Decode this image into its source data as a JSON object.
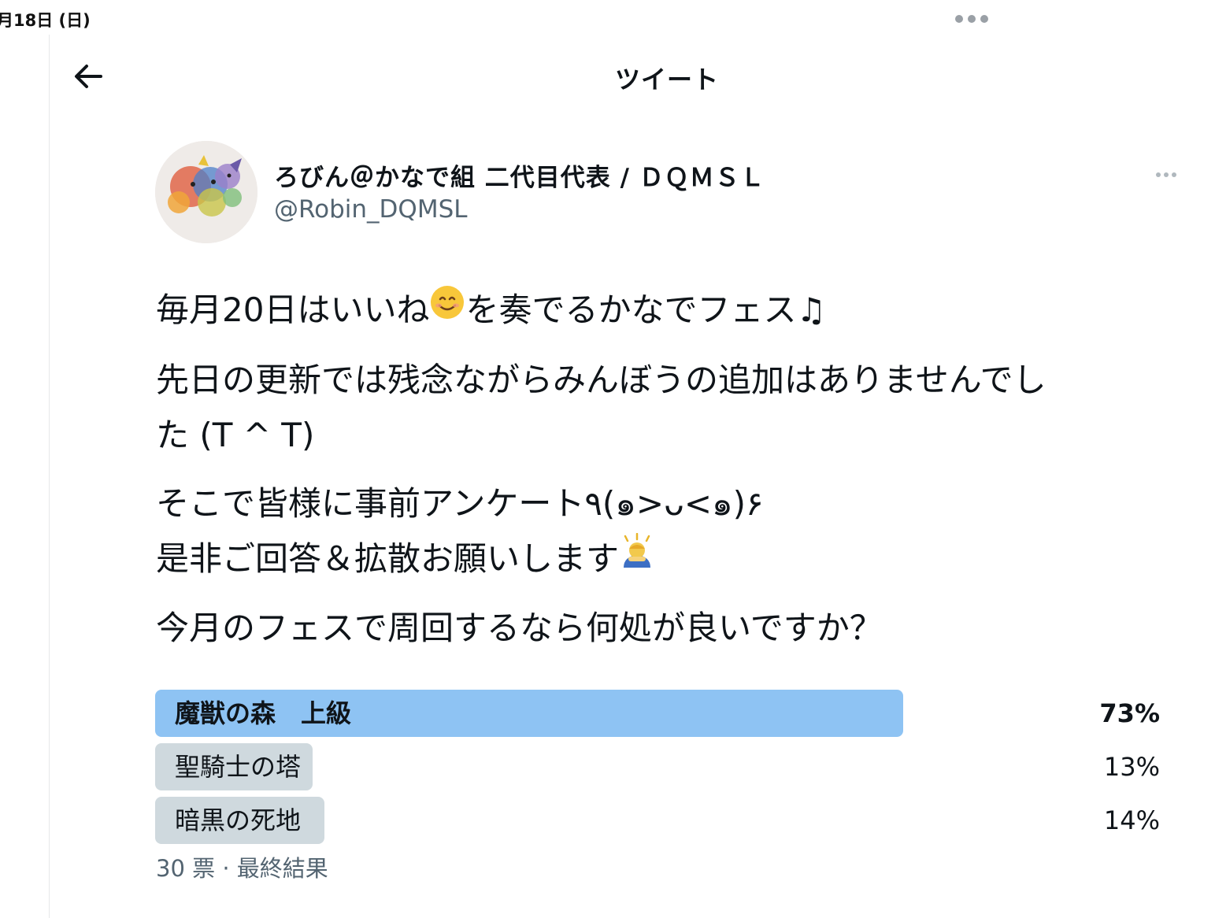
{
  "status_bar": {
    "date": "月18日 (日)"
  },
  "header": {
    "title": "ツイート",
    "back_icon": "arrow-left-icon"
  },
  "author": {
    "display_name": "ろびん＠かなで組 二代目代表 / ＤＱＭＳＬ",
    "handle": "@Robin_DQMSL"
  },
  "tweet": {
    "line1_a": "毎月20日はいいね",
    "line1_b": "を奏でるかなでフェス♫",
    "line2": "先日の更新では残念ながらみんぼうの追加はありませんでし",
    "line3": "た (T ^ T)",
    "line4": "そこで皆様に事前アンケート٩(๑>ᴗ<๑)۶",
    "line5": "是非ご回答＆拡散お願いします",
    "line6": "今月のフェスで周回するなら何処が良いですか？",
    "emoji_1": "smiling-face-emoji",
    "emoji_2": "bowing-person-emoji"
  },
  "poll": {
    "options": [
      {
        "label": "魔獣の森　上級",
        "percent_text": "73%",
        "percent": 73,
        "winner": true
      },
      {
        "label": "聖騎士の塔",
        "percent_text": "13%",
        "percent": 13,
        "winner": false
      },
      {
        "label": "暗黒の死地",
        "percent_text": "14%",
        "percent": 14,
        "winner": false
      }
    ],
    "meta": "30 票 · 最終結果"
  },
  "colors": {
    "winner_bar": "#8ec3f3",
    "loser_bar": "#cfd9de",
    "secondary_text": "#536471"
  }
}
